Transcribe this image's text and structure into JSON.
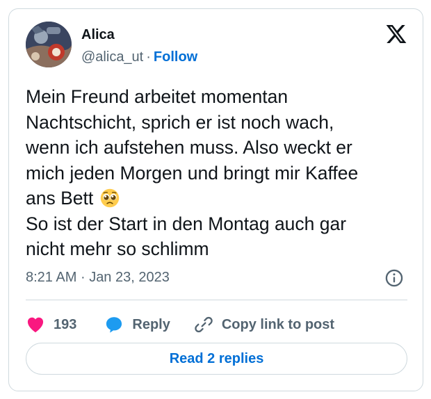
{
  "author": {
    "name": "Alica",
    "handle": "@alica_ut",
    "separator": "·",
    "follow_label": "Follow"
  },
  "tweet": {
    "lines": [
      "Mein Freund arbeitet momentan",
      "Nachtschicht, sprich er ist noch wach,",
      "wenn ich aufstehen muss. Also weckt er",
      "mich jeden Morgen und bringt mir Kaffee",
      "ans Bett",
      "So ist der Start in den Montag auch gar",
      "nicht mehr so schlimm"
    ],
    "emoji": "pleading-face-icon"
  },
  "meta": {
    "time": "8:21 AM",
    "separator": "·",
    "date": "Jan 23, 2023"
  },
  "actions": {
    "likes": "193",
    "reply_label": "Reply",
    "copy_label": "Copy link to post"
  },
  "read_replies_label": "Read 2 replies",
  "colors": {
    "accent": "#006fd6",
    "heart": "#f91880",
    "reply_bubble": "#1d9bf0",
    "muted": "#536471",
    "text": "#0f1419",
    "border": "#cfd9de"
  }
}
